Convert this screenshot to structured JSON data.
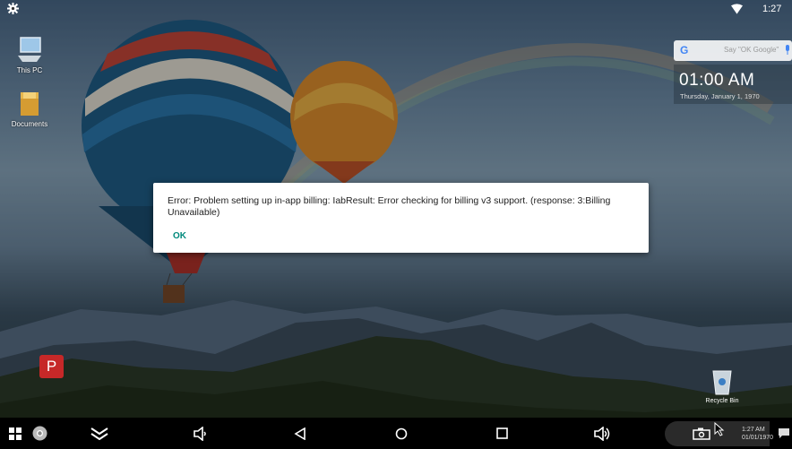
{
  "status_bar": {
    "time": "1:27",
    "settings_icon": "gear-icon",
    "wifi_icon": "wifi-icon"
  },
  "desktop": {
    "icons": [
      {
        "label": "This PC",
        "icon": "computer-icon"
      },
      {
        "label": "Documents",
        "icon": "folder-icon"
      }
    ],
    "app_icon": {
      "letter": "P",
      "color": "#c62828"
    },
    "recycle_bin": {
      "label": "Recycle Bin",
      "icon": "recycle-bin-icon"
    }
  },
  "google_widget": {
    "logo": "G",
    "hint": "Say \"OK Google\""
  },
  "clock_widget": {
    "time": "01:00 AM",
    "date": "Thursday, January 1, 1970"
  },
  "dialog": {
    "message": "Error: Problem setting up in-app billing: IabResult: Error checking for billing v3 support. (response: 3:Billing Unavailable)",
    "ok_label": "OK"
  },
  "taskbar": {
    "items": [
      "start-icon",
      "chrome-icon",
      "collapse-icon",
      "volume-down-icon",
      "back-icon",
      "home-icon",
      "recents-icon",
      "volume-up-icon",
      "screenshot-icon",
      "notification-icon"
    ],
    "clock_time": "1:27 AM",
    "clock_date": "01/01/1970"
  }
}
